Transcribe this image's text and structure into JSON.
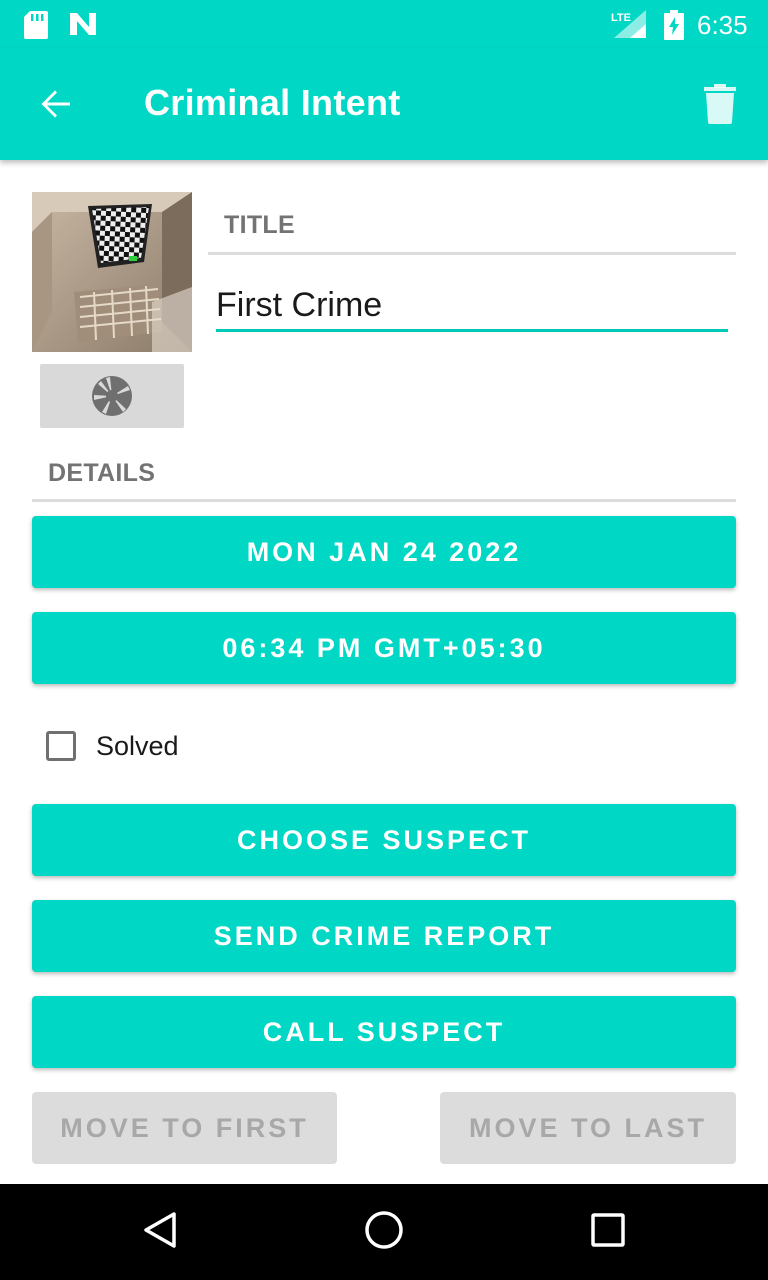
{
  "status_bar": {
    "time": "6:35",
    "network": "LTE",
    "icons": [
      "sd-card-icon",
      "n-logo-icon",
      "lte-signal-icon",
      "battery-charging-icon"
    ]
  },
  "app_bar": {
    "title": "Criminal Intent",
    "back_icon": "arrow-left-icon",
    "delete_icon": "trash-icon"
  },
  "crime": {
    "title_label": "TITLE",
    "title_value": "First Crime",
    "details_label": "DETAILS",
    "date_button": "MON JAN 24 2022",
    "time_button": "06:34 PM GMT+05:30",
    "solved_label": "Solved",
    "solved_checked": false,
    "camera_icon": "camera-shutter-icon"
  },
  "actions": {
    "choose_suspect": "CHOOSE SUSPECT",
    "send_report": "SEND CRIME REPORT",
    "call_suspect": "CALL SUSPECT",
    "move_first": "MOVE TO FIRST",
    "move_last": "MOVE TO LAST"
  },
  "nav_bar": {
    "icons": [
      "back-triangle-icon",
      "home-circle-icon",
      "recents-square-icon"
    ]
  },
  "colors": {
    "accent": "#00d7c4",
    "disabled_bg": "#dcdcdc",
    "disabled_text": "#a8a8a8",
    "label_gray": "#737373"
  }
}
